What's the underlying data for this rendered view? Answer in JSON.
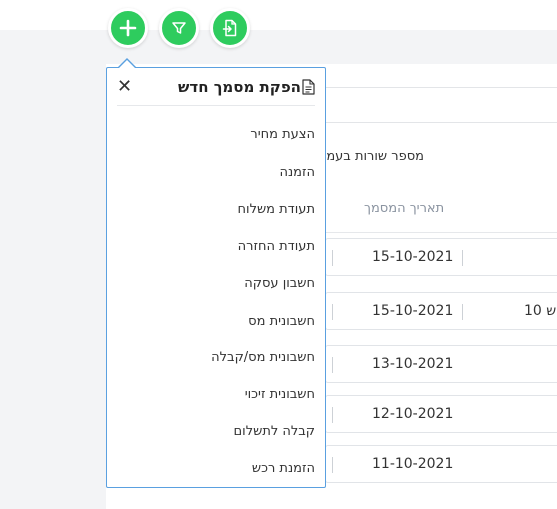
{
  "toolbar": {
    "add_icon": "plus-icon",
    "filter_icon": "filter-icon",
    "import_icon": "file-import-icon",
    "accent": "#2ecc5e"
  },
  "dropdown": {
    "title": "הפקת מסמך חדש",
    "items": [
      "הצעת מחיר",
      "הזמנה",
      "תעודת משלוח",
      "תעודת החזרה",
      "חשבון עסקה",
      "חשבונית מס",
      "חשבונית מס/קבלה",
      "חשבונית זיכוי",
      "קבלה לתשלום",
      "הזמנת רכש"
    ]
  },
  "table": {
    "rows_per_page_label": "מספר שורות בעמ",
    "date_header": "תאריך המסמך",
    "rows": [
      {
        "date": "15-10-2021",
        "extra": ""
      },
      {
        "date": "15-10-2021",
        "extra": "ש 10"
      },
      {
        "date": "13-10-2021",
        "extra": ""
      },
      {
        "date": "12-10-2021",
        "extra": ""
      },
      {
        "date": "11-10-2021",
        "extra": ""
      }
    ]
  }
}
